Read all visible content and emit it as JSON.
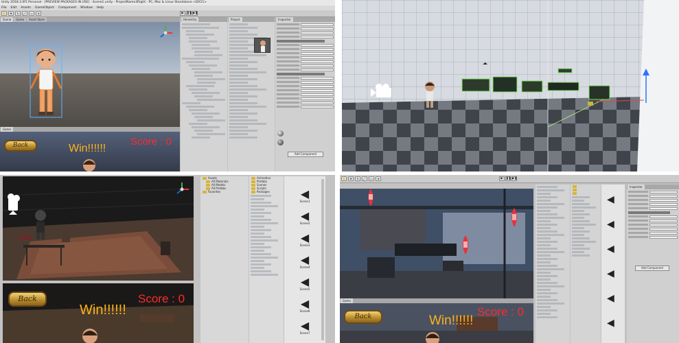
{
  "top_left": {
    "window_title": "Unity 2018.3.0f1 Personal - [PREVIEW PACKAGES IN USE] - Scene1.unity - ProjectName3Right - PC, Mac & Linux Standalone <DX11>",
    "menu": [
      "File",
      "Edit",
      "Assets",
      "GameObject",
      "Component",
      "Window",
      "Help"
    ],
    "scene_tabs": [
      "Scene",
      "Game",
      "Asset Store"
    ],
    "hierarchy_tab": "Hierarchy",
    "project_tab": "Project",
    "inspector_tab": "Inspector",
    "add_component": "Add Component",
    "game_tab": "Game",
    "back_label": "Back",
    "win_label": "Win!!!!!!",
    "score_label": "Score : 0"
  },
  "bottom_left": {
    "back_label": "Back",
    "win_label": "Win!!!!!!",
    "score_label": "Score : 0",
    "project_items": [
      "Assets",
      "All Materials",
      "All Models",
      "All Prefabs",
      "Favorites",
      "Animation",
      "Prefabs",
      "Scenes",
      "Scripts",
      "Packages"
    ],
    "asset_names": [
      "Scene1",
      "Scene2",
      "Scene3",
      "Scene4",
      "Scene5",
      "Scene6",
      "Scene7"
    ]
  },
  "bottom_right": {
    "back_label": "Back",
    "win_label": "Win!!!!!!",
    "score_label": "Score : 0",
    "add_component": "Add Component",
    "inspector_tab": "Inspector",
    "game_tab": "Game"
  },
  "colors": {
    "win": "#ffb21b",
    "score": "#ff2a2a",
    "editor_gray": "#c2c2c2"
  }
}
